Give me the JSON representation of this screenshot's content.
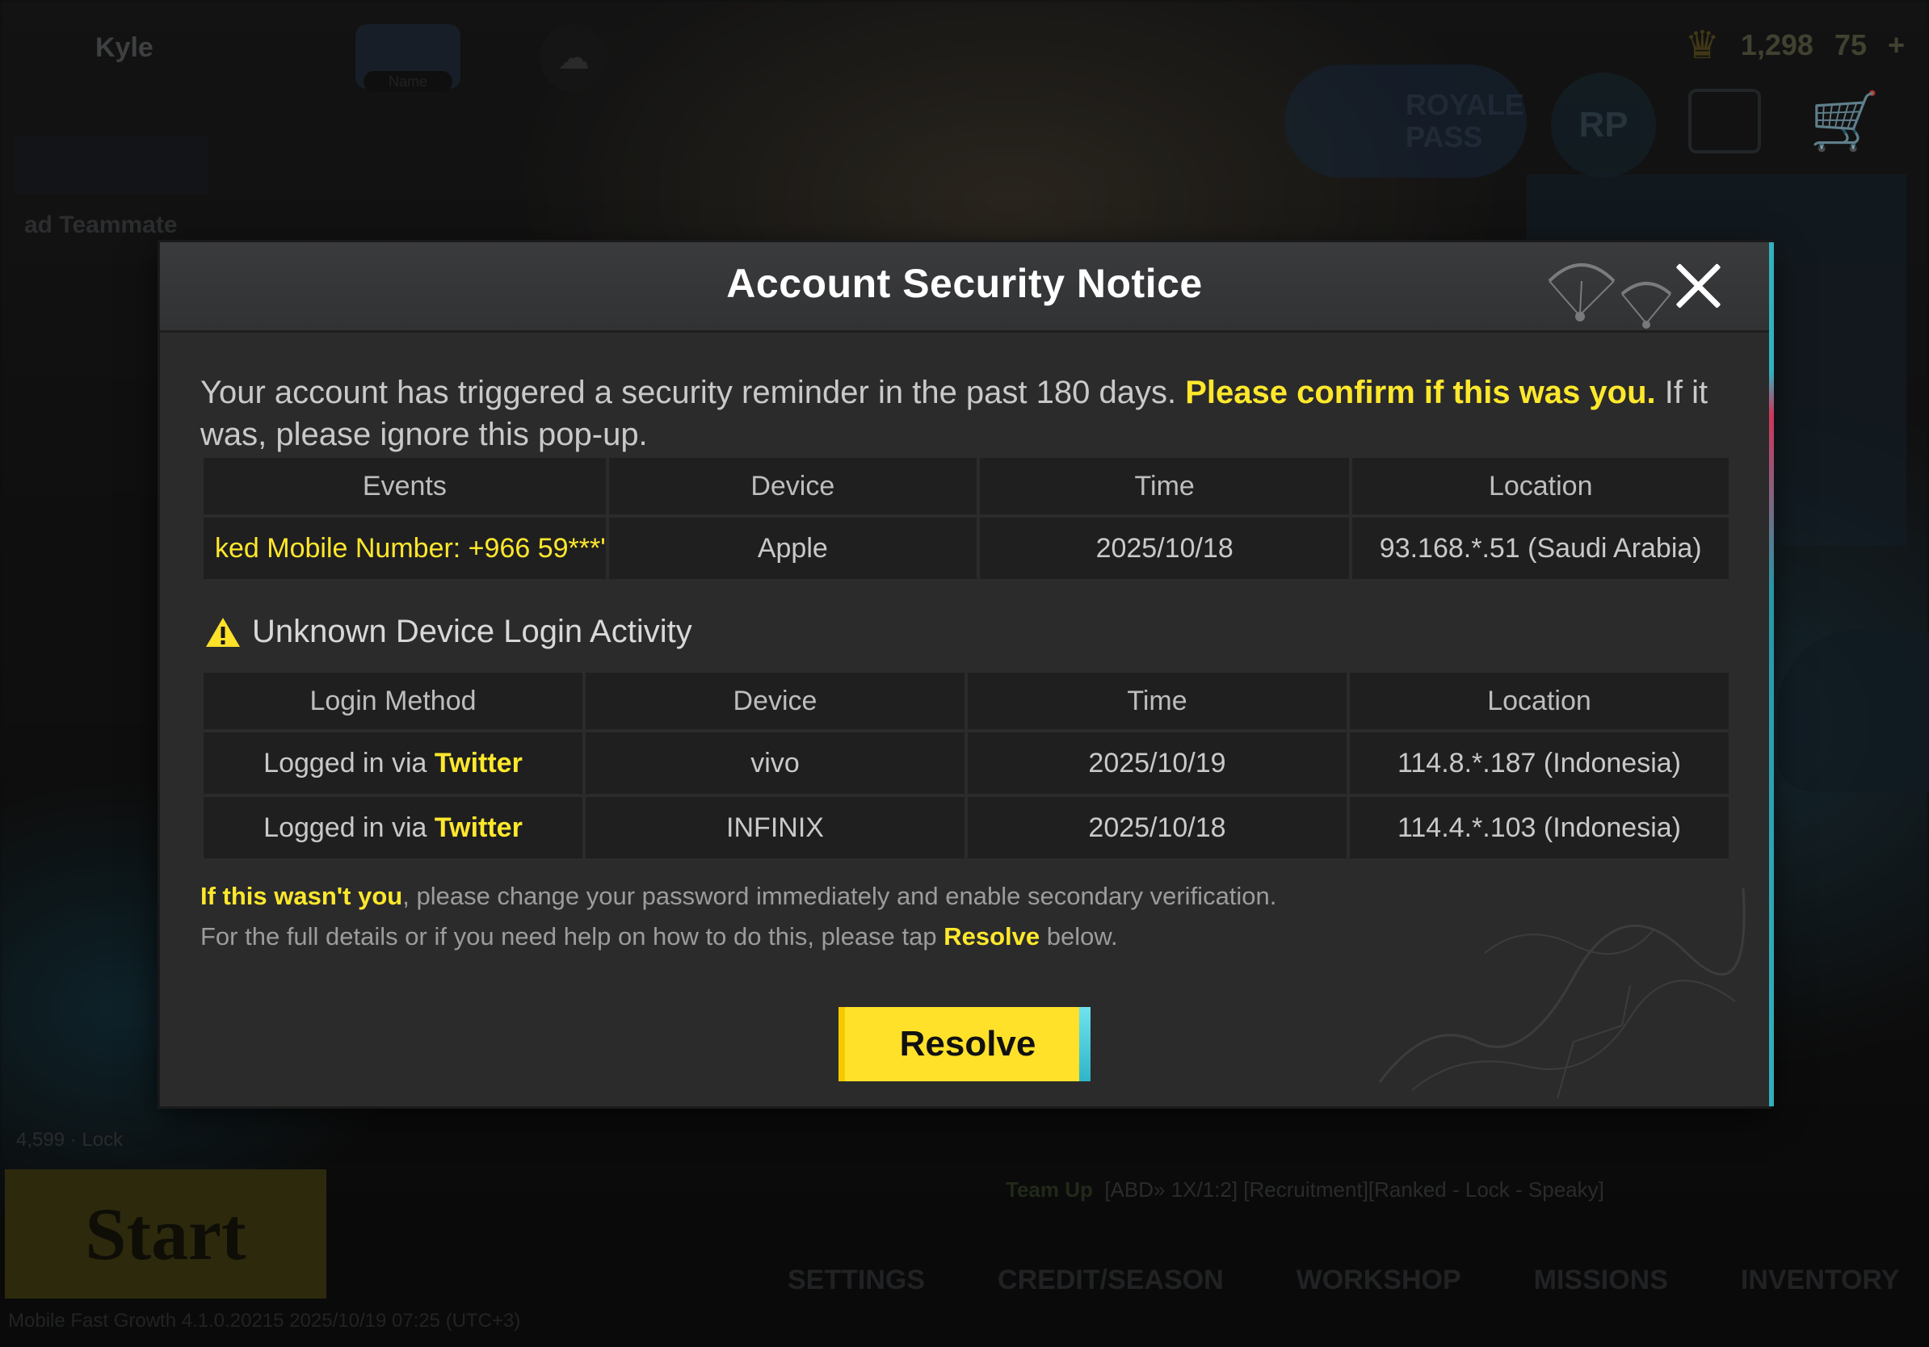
{
  "background": {
    "player_name": "Kyle",
    "guest_badge": "Name",
    "teammate_label": "ad Teammate",
    "currency_values": [
      "1,298",
      "75"
    ],
    "royale_pass_label": "ROYALE PASS",
    "rp_label": "RP",
    "start_label": "Start",
    "team_up_label": "Team Up",
    "team_up_text": "[ABD» 1X/1:2] [Recruitment][Ranked - Lock - Speaky]",
    "nav_items": [
      "SETTINGS",
      "CREDIT/SEASON",
      "WORKSHOP",
      "MISSIONS",
      "INVENTORY"
    ],
    "status_text": "Mobile Fast  Growth   4.1.0.20215 2025/10/19 07:25 (UTC+3)",
    "lock_text": "4,599 · Lock"
  },
  "modal": {
    "title": "Account Security Notice",
    "intro_part1": "Your account has triggered a security reminder in the past 180 days. ",
    "intro_highlight": "Please confirm if this was you.",
    "intro_part2": " If it was, please ignore this pop-up.",
    "events_table": {
      "headers": [
        "Events",
        "Device",
        "Time",
        "Location"
      ],
      "rows": [
        [
          "ked Mobile Number: +966 59***'",
          "Apple",
          "2025/10/18",
          "93.168.*.51 (Saudi Arabia)"
        ]
      ]
    },
    "section_title": "Unknown Device Login Activity",
    "login_table": {
      "headers": [
        "Login Method",
        "Device",
        "Time",
        "Location"
      ],
      "rows": [
        {
          "method_prefix": "Logged in via ",
          "method_highlight": "Twitter",
          "device": "vivo",
          "time": "2025/10/19",
          "location": "114.8.*.187 (Indonesia)"
        },
        {
          "method_prefix": "Logged in via ",
          "method_highlight": "Twitter",
          "device": "INFINIX",
          "time": "2025/10/18",
          "location": "114.4.*.103 (Indonesia)"
        }
      ]
    },
    "footer1_highlight": "If this wasn't you",
    "footer1_rest": ", please change your password immediately and enable secondary verification.",
    "footer2_part1": "For the full details or if you need help on how to do this, please tap ",
    "footer2_highlight": "Resolve",
    "footer2_part2": " below.",
    "resolve_label": "Resolve"
  },
  "colors": {
    "accent_yellow": "#ffe82c",
    "panel_bg": "#2b2b2c",
    "cell_bg": "#1f1f20",
    "edge_cyan": "#3ad7e8"
  },
  "icons": [
    "close-icon",
    "warning-icon",
    "parachute-icon",
    "crown-icon",
    "cart-icon",
    "cloud-icon"
  ]
}
